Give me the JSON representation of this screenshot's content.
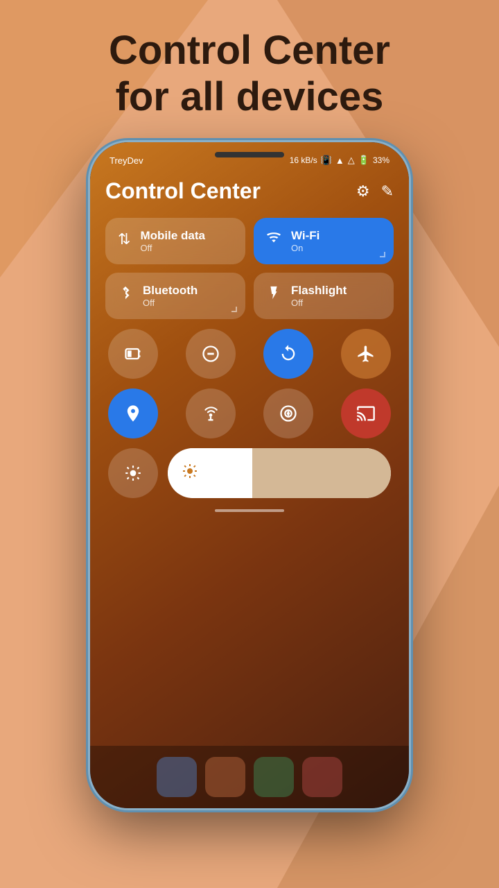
{
  "hero": {
    "title_line1": "Control Center",
    "title_line2": "for all devices"
  },
  "status_bar": {
    "carrier": "TreyDev",
    "speed": "16 kB/s",
    "battery": "33%"
  },
  "control_center": {
    "title": "Control Center",
    "tiles": [
      {
        "id": "mobile-data",
        "name": "Mobile data",
        "status": "Off",
        "active": false,
        "icon": "⇅"
      },
      {
        "id": "wifi",
        "name": "Wi-Fi",
        "status": "On",
        "active": true,
        "icon": "▲"
      },
      {
        "id": "bluetooth",
        "name": "Bluetooth",
        "status": "Off",
        "active": false,
        "icon": "✱"
      },
      {
        "id": "flashlight",
        "name": "Flashlight",
        "status": "Off",
        "active": false,
        "icon": "🔦"
      }
    ],
    "circles_row1": [
      {
        "id": "battery-saver",
        "icon": "⊟",
        "active": false
      },
      {
        "id": "dnd",
        "icon": "⊖",
        "active": false
      },
      {
        "id": "rotate",
        "icon": "↺",
        "active": true,
        "color": "blue"
      },
      {
        "id": "airplane",
        "icon": "✈",
        "active": false,
        "color": "orange"
      }
    ],
    "circles_row2": [
      {
        "id": "location",
        "icon": "📍",
        "active": true,
        "color": "blue"
      },
      {
        "id": "hotspot",
        "icon": "📶",
        "active": false
      },
      {
        "id": "nfc",
        "icon": "⊕",
        "active": false
      },
      {
        "id": "cast",
        "icon": "⊡",
        "active": false,
        "color": "red"
      }
    ],
    "brightness": {
      "label": "Brightness",
      "value": 38
    }
  }
}
